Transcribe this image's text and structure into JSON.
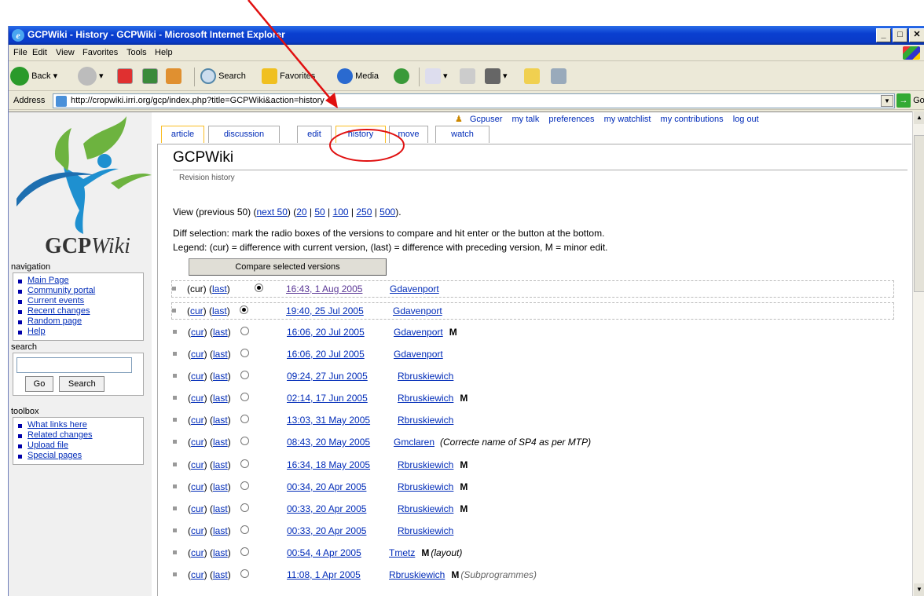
{
  "window": {
    "title": "GCPWiki - History - GCPWiki - Microsoft Internet Explorer"
  },
  "menu": [
    "File",
    "Edit",
    "View",
    "Favorites",
    "Tools",
    "Help"
  ],
  "toolbar": {
    "back": "Back",
    "search": "Search",
    "favorites": "Favorites",
    "media": "Media"
  },
  "address": {
    "label": "Address",
    "url": "http://cropwiki.irri.org/gcp/index.php?title=GCPWiki&action=history",
    "go": "Go"
  },
  "logo": {
    "text_bold": "GCP",
    "text_italic": "Wiki"
  },
  "sidebar": {
    "navigation": {
      "title": "navigation",
      "items": [
        "Main Page",
        "Community portal",
        "Current events",
        "Recent changes",
        "Random page",
        "Help"
      ]
    },
    "search": {
      "title": "search",
      "go": "Go",
      "search": "Search"
    },
    "toolbox": {
      "title": "toolbox",
      "items": [
        "What links here",
        "Related changes",
        "Upload file",
        "Special pages"
      ]
    }
  },
  "personal": {
    "user": "Gcpuser",
    "links": [
      "my talk",
      "preferences",
      "my watchlist",
      "my contributions",
      "log out"
    ]
  },
  "tabs": [
    "article",
    "discussion",
    "edit",
    "history",
    "move",
    "watch"
  ],
  "page": {
    "title": "GCPWiki",
    "subtitle": "Revision history",
    "view": {
      "prefix": "View (previous 50) (",
      "next": "next 50",
      "mid": ") (",
      "sizes": [
        "20",
        "50",
        "100",
        "250",
        "500"
      ],
      "suffix": ")."
    },
    "diff_help": "Diff selection: mark the radio boxes of the versions to compare and hit enter or the button at the bottom.",
    "legend": "Legend: (cur) = difference with current version, (last) = difference with preceding version, M = minor edit.",
    "compare_button": "Compare selected versions"
  },
  "revisions": [
    {
      "date": "16:43, 1 Aug 2005",
      "user": "Gdavenport",
      "minor": "",
      "comment": ""
    },
    {
      "date": "19:40, 25 Jul 2005",
      "user": "Gdavenport",
      "minor": "",
      "comment": ""
    },
    {
      "date": "16:06, 20 Jul 2005",
      "user": "Gdavenport",
      "minor": "M",
      "comment": ""
    },
    {
      "date": "16:06, 20 Jul 2005",
      "user": "Gdavenport",
      "minor": "",
      "comment": ""
    },
    {
      "date": "09:24, 27 Jun 2005",
      "user": "Rbruskiewich",
      "minor": "",
      "comment": ""
    },
    {
      "date": "02:14, 17 Jun 2005",
      "user": "Rbruskiewich",
      "minor": "M",
      "comment": ""
    },
    {
      "date": "13:03, 31 May 2005",
      "user": "Rbruskiewich",
      "minor": "",
      "comment": ""
    },
    {
      "date": "08:43, 20 May 2005",
      "user": "Gmclaren",
      "minor": "",
      "comment": "(Correcte name of SP4 as per MTP)"
    },
    {
      "date": "16:34, 18 May 2005",
      "user": "Rbruskiewich",
      "minor": "M",
      "comment": ""
    },
    {
      "date": "00:34, 20 Apr 2005",
      "user": "Rbruskiewich",
      "minor": "M",
      "comment": ""
    },
    {
      "date": "00:33, 20 Apr 2005",
      "user": "Rbruskiewich",
      "minor": "M",
      "comment": ""
    },
    {
      "date": "00:33, 20 Apr 2005",
      "user": "Rbruskiewich",
      "minor": "",
      "comment": ""
    },
    {
      "date": "00:54, 4 Apr 2005",
      "user": "Tmetz",
      "minor": "M",
      "comment": "(layout)"
    },
    {
      "date": "11:08, 1 Apr 2005",
      "user": "Rbruskiewich",
      "minor": "M",
      "comment": "(Subprogrammes)"
    }
  ],
  "revision_labels": {
    "cur": "cur",
    "last": "last"
  },
  "colors": {
    "annotation": "#e01010",
    "link": "#002bb8",
    "selected_tab": "#fabd23"
  }
}
